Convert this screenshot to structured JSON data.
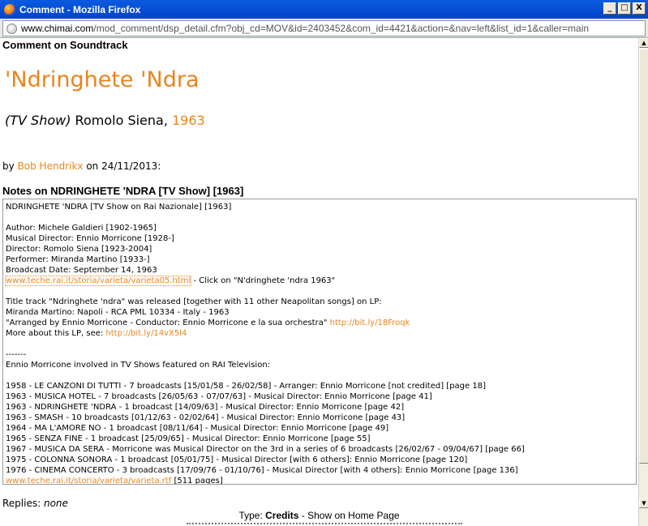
{
  "window": {
    "title": "Comment - Mozilla Firefox",
    "minimize_glyph": "_",
    "maximize_glyph": "□",
    "close_glyph": "X"
  },
  "address": {
    "host": "www.chimai.com",
    "path": "/mod_comment/dsp_detail.cfm?obj_cd=MOV&id=2403452&com_id=4421&action=&nav=left&list_id=1&caller=main"
  },
  "page": {
    "heading": "Comment on Soundtrack",
    "title": "'Ndringhete 'Ndra",
    "kind": "(TV Show)",
    "director": " Romolo Siena, ",
    "year": "1963",
    "by_prefix": "by ",
    "author": "Bob Hendrikx",
    "date_text": " on 24/11/2013:",
    "notes_heading": "Notes on NDRINGHETE 'NDRA [TV Show] [1963]"
  },
  "notes": {
    "l01": "NDRINGHETE 'NDRA [TV Show on Rai Nazionale] [1963]",
    "l03": "Author: Michele Galdieri [1902-1965]",
    "l04": "Musical Director: Ennio Morricone [1928-]",
    "l05": "Director: Romolo Siena [1923-2004]",
    "l06": "Performer: Miranda Martino [1933-]",
    "l07": "Broadcast Date: September 14, 1963",
    "l08_link": "www.teche.rai.it/storia/varieta/varieta05.html",
    "l08_rest": " - Click on \"N'dringhete 'ndra 1963\"",
    "l10": "Title track \"Ndringhete 'ndra\" was released [together with 11 other Neapolitan songs] on LP:",
    "l11": "Miranda Martino: Napoli - RCA PML 10334 - Italy - 1963",
    "l12_text": "\"Arranged by Ennio Morricone - Conductor: Ennio Morricone e la sua orchestra\" ",
    "l12_link": "http://bit.ly/18Froqk",
    "l13_text": "More about this LP, see: ",
    "l13_link": "http://bit.ly/14vX5l4",
    "l15": "-------",
    "l16": "Ennio Morricone involved in TV Shows featured on RAI Television:",
    "l18": "1958 - LE CANZONI DI TUTTI - 7 broadcasts [15/01/58 - 26/02/58] - Arranger: Ennio Morricone [not credited] [page 18]",
    "l19": "1963 - MUSICA HOTEL - 7 broadcasts [26/05/63 - 07/07/63] - Musical Director: Ennio Morricone [page 41]",
    "l20": "1963 - NDRINGHETE 'NDRA - 1 broadcast [14/09/63] - Musical Director: Ennio Morricone [page 42]",
    "l21": "1963 - SMASH - 10 broadcasts [01/12/63 - 02/02/64] - Musical Director: Ennio Morricone [page 43]",
    "l22": "1964 - MA L'AMORE NO - 1 broadcast [08/11/64] - Musical Director: Ennio Morricone [page 49]",
    "l23": "1965 - SENZA FINE - 1 broadcast [25/09/65] - Musical Director: Ennio Morricone [page 55]",
    "l24": "1967 - MUSICA DA SERA - Morricone was Musical Director on the 3rd in a series of 6 broadcasts [26/02/67 - 09/04/67] [page 66]",
    "l25": "1975 - COLONNA SONORA - 1 broadcast [05/01/75] - Musical Director [with 6 others]: Ennio Morricone [page 120]",
    "l26": "1976 - CINEMA CONCERTO - 3 broadcasts [17/09/76 - 01/10/76] - Musical Director [with 4 others]: Ennio Morricone [page 136]",
    "l27_link": "www.teche.rai.it/storia/varieta/varieta.rtf",
    "l27_rest": " [511 pages]"
  },
  "footer": {
    "replies_label": "Replies: ",
    "replies_value": "none",
    "type_label": "Type: ",
    "type_value": "Credits",
    "type_rest": "  - Show on Home Page"
  },
  "scrollbar": {
    "up_glyph": "▲",
    "down_glyph": "▼"
  }
}
